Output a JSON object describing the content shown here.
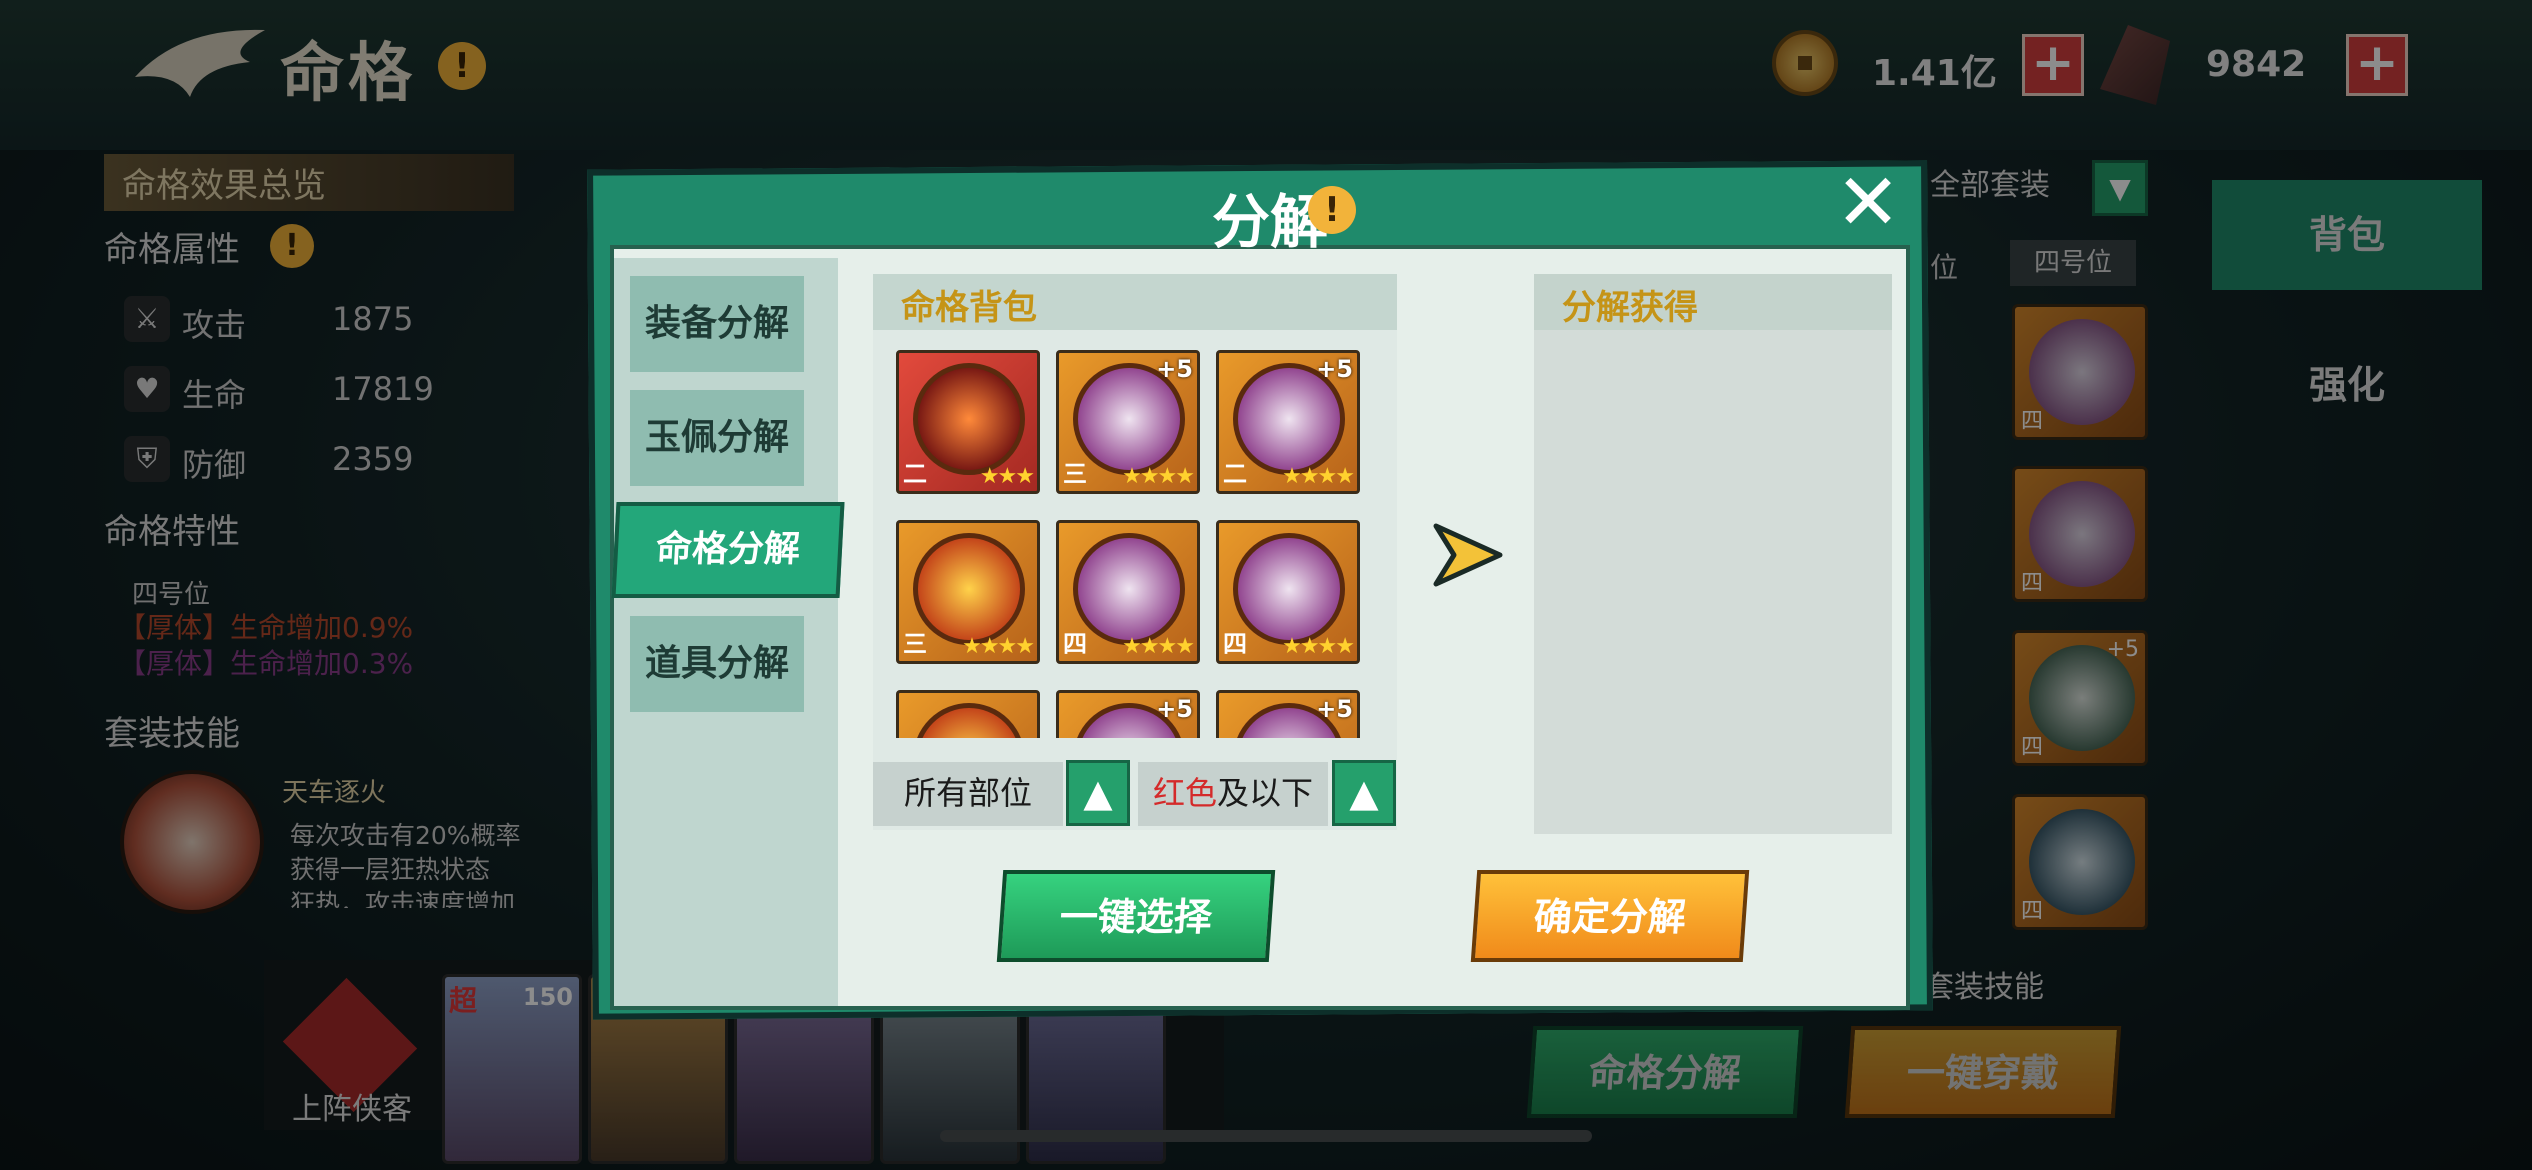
{
  "header": {
    "title": "命格",
    "coins": "1.41亿",
    "crystals": "9842",
    "plus": "+"
  },
  "left_panel": {
    "overview_title": "命格效果总览",
    "attributes_title": "命格属性",
    "stats": [
      {
        "icon": "sword-icon",
        "label": "攻击",
        "value": "1875"
      },
      {
        "icon": "heart-icon",
        "label": "生命",
        "value": "17819"
      },
      {
        "icon": "shield-icon",
        "label": "防御",
        "value": "2359"
      }
    ],
    "traits_title": "命格特性",
    "trait_slot": "四号位",
    "traits": [
      "【厚体】生命增加0.9%",
      "【厚体】生命增加0.3%"
    ],
    "set_skill_title": "套装技能",
    "skill_name": "天车逐火",
    "skill_desc": [
      "每次攻击有20%概率",
      "获得一层狂热状态",
      "狂热，攻击速度增加"
    ]
  },
  "right_panel": {
    "set_filter": "全部套装",
    "slot_partial": "位",
    "slot_tag": "四号位",
    "tabs": [
      "背包",
      "强化"
    ],
    "card_tiers": [
      "四",
      "四",
      "四",
      "四",
      "四"
    ],
    "card_plus": "+5",
    "set_skill_label": "套装技能",
    "btn_decompose": "命格分解",
    "btn_equip_all": "一键穿戴"
  },
  "bottom": {
    "deploy_label": "上阵侠客",
    "level": "150",
    "badge": "超"
  },
  "modal": {
    "title": "分解",
    "close": "✕",
    "subtabs": [
      "装备分解",
      "玉佩分解",
      "命格分解",
      "道具分解"
    ],
    "bag_title": "命格背包",
    "result_title": "分解获得",
    "cards": [
      {
        "tier": "二",
        "stars": "★★★",
        "plus": "",
        "color": "red"
      },
      {
        "tier": "三",
        "stars": "★★★★",
        "plus": "+5",
        "color": "orange"
      },
      {
        "tier": "二",
        "stars": "★★★★",
        "plus": "+5",
        "color": "orange"
      },
      {
        "tier": "三",
        "stars": "★★★★",
        "plus": "",
        "color": "orange"
      },
      {
        "tier": "四",
        "stars": "★★★★",
        "plus": "",
        "color": "orange"
      },
      {
        "tier": "四",
        "stars": "★★★★",
        "plus": "",
        "color": "orange"
      },
      {
        "tier": "",
        "stars": "",
        "plus": "",
        "color": "orange"
      },
      {
        "tier": "",
        "stars": "",
        "plus": "+5",
        "color": "orange"
      },
      {
        "tier": "",
        "stars": "",
        "plus": "+5",
        "color": "orange"
      }
    ],
    "filter_slot": "所有部位",
    "filter_quality_red": "红色",
    "filter_quality_rest": "及以下",
    "btn_select": "一键选择",
    "btn_confirm": "确定分解"
  },
  "colors": {
    "accent_green": "#23a77a",
    "accent_orange": "#f6a52a",
    "title_gold": "#c59417"
  }
}
